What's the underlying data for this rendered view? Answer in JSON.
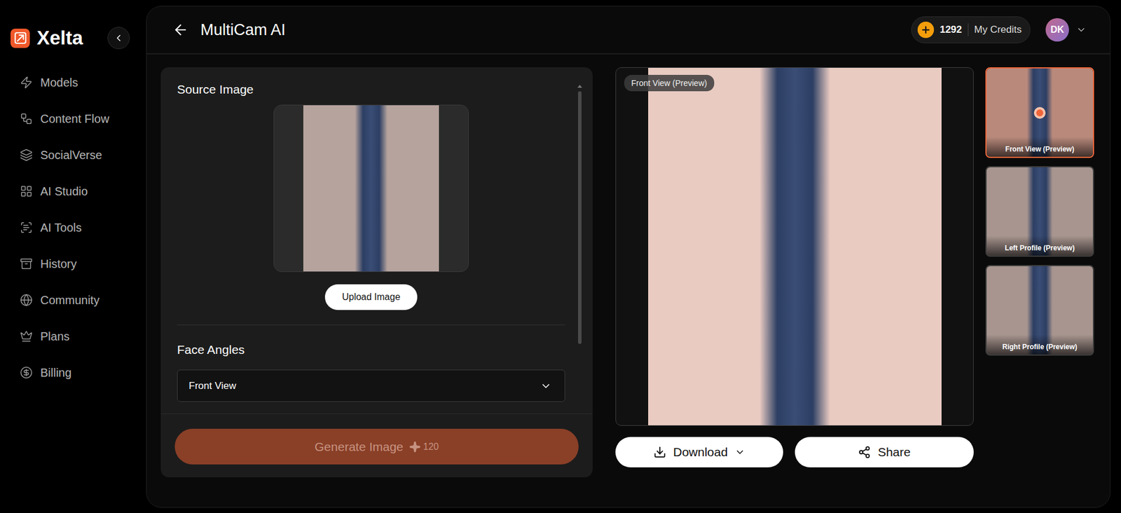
{
  "sidebar": {
    "logo": "Xelta",
    "items": [
      {
        "label": "Models"
      },
      {
        "label": "Content Flow"
      },
      {
        "label": "SocialVerse"
      },
      {
        "label": "AI Studio"
      },
      {
        "label": "AI Tools"
      },
      {
        "label": "History"
      },
      {
        "label": "Community"
      },
      {
        "label": "Plans"
      },
      {
        "label": "Billing"
      }
    ]
  },
  "header": {
    "title": "MultiCam AI",
    "credits": "1292",
    "credits_label": "My Credits",
    "avatar": "DK"
  },
  "source": {
    "title": "Source Image",
    "upload_button": "Upload Image",
    "scrollbar": {
      "level": 0.8
    }
  },
  "face_angles": {
    "label": "Face Angles",
    "value": "Front View"
  },
  "generate": {
    "label": "Generate Image",
    "cost": "120",
    "disabled": true
  },
  "preview": {
    "badge": "Front View (Preview)"
  },
  "actions": {
    "download": "Download",
    "share": "Share"
  },
  "thumbnails": [
    {
      "label": "Front View (Preview)",
      "selected": true
    },
    {
      "label": "Left Profile (Preview)",
      "selected": false
    },
    {
      "label": "Right Profile (Preview)",
      "selected": false
    }
  ]
}
